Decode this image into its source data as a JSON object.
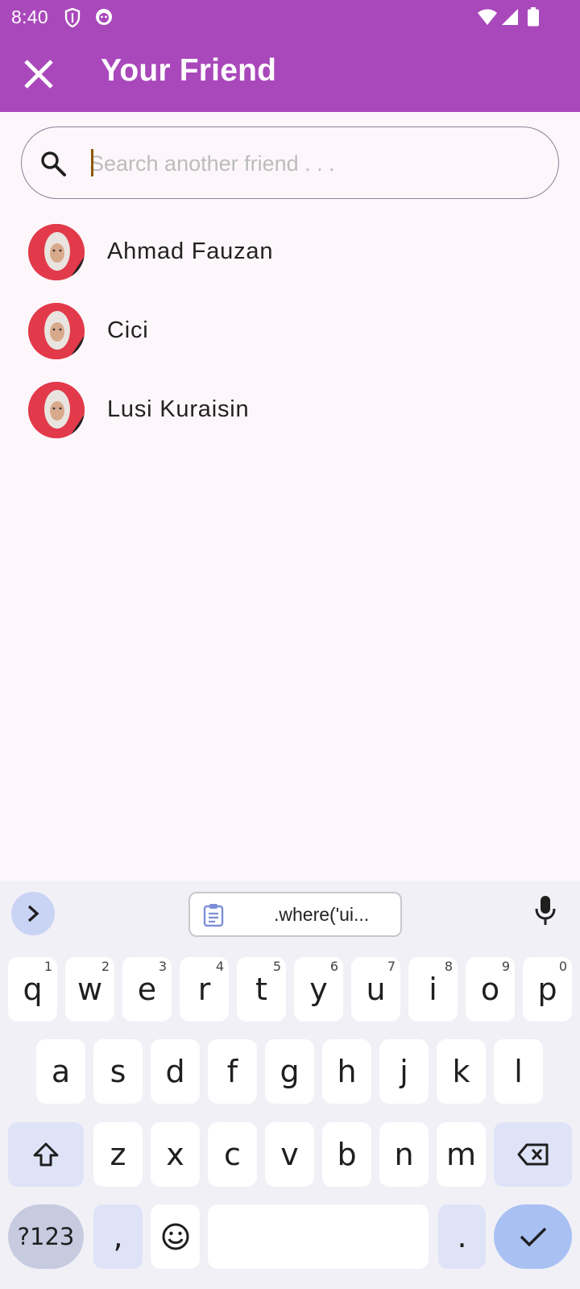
{
  "status_bar": {
    "time": "8:40",
    "icons": [
      "shield-icon",
      "cat-face-icon",
      "wifi-icon",
      "signal-icon",
      "battery-icon"
    ]
  },
  "app_bar": {
    "title": "Your Friend",
    "close_icon": "close-icon"
  },
  "search": {
    "placeholder": "Search another friend . . .",
    "value": ""
  },
  "friends": [
    {
      "name": "Ahmad Fauzan"
    },
    {
      "name": "Cici"
    },
    {
      "name": "Lusi Kuraisin"
    }
  ],
  "keyboard": {
    "clipboard_text": ".where('ui...",
    "row1": [
      {
        "key": "q",
        "hint": "1"
      },
      {
        "key": "w",
        "hint": "2"
      },
      {
        "key": "e",
        "hint": "3"
      },
      {
        "key": "r",
        "hint": "4"
      },
      {
        "key": "t",
        "hint": "5"
      },
      {
        "key": "y",
        "hint": "6"
      },
      {
        "key": "u",
        "hint": "7"
      },
      {
        "key": "i",
        "hint": "8"
      },
      {
        "key": "o",
        "hint": "9"
      },
      {
        "key": "p",
        "hint": "0"
      }
    ],
    "row2": [
      "a",
      "s",
      "d",
      "f",
      "g",
      "h",
      "j",
      "k",
      "l"
    ],
    "row3": [
      "z",
      "x",
      "c",
      "v",
      "b",
      "n",
      "m"
    ],
    "symbols_label": "?123",
    "comma": ",",
    "period": "."
  },
  "colors": {
    "app_bar": "#a948bb",
    "background": "#fdf7fb",
    "keyboard_bg": "#f1f0f6",
    "enter_key": "#a8c0f2"
  }
}
